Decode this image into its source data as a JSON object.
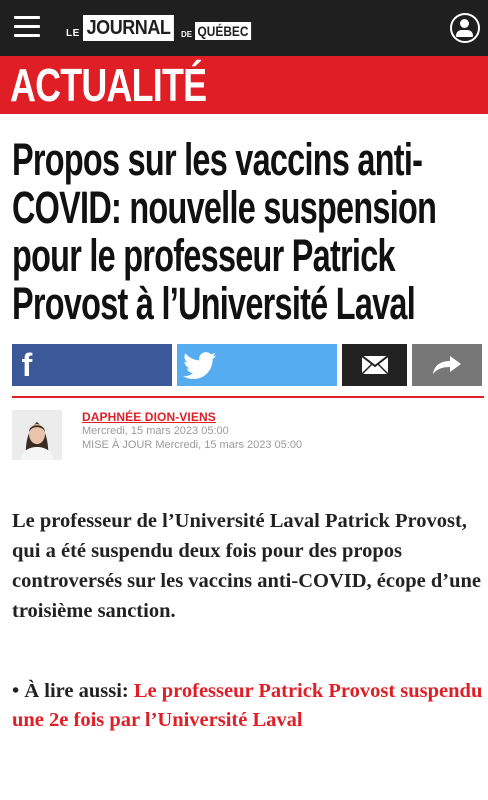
{
  "header": {
    "logo": {
      "le": "LE",
      "journal": "JOURNAL",
      "de": "DE",
      "quebec": "QUÉBEC"
    },
    "menu_icon": "hamburger-menu-icon",
    "account_icon": "user-account-icon",
    "bar_color": "#1f1f1f"
  },
  "section": {
    "label": "ACTUALITÉ",
    "color": "#e01e26"
  },
  "article": {
    "headline": "Propos sur les vaccins anti-COVID: nouvelle suspension pour le professeur Patrick Provost à l’Université Laval",
    "share": {
      "facebook_icon": "facebook-icon",
      "facebook_glyph": "f",
      "twitter_icon": "twitter-icon",
      "email_icon": "email-icon",
      "share_icon": "share-arrow-icon",
      "colors": {
        "facebook": "#3b5998",
        "twitter": "#55acee",
        "email": "#222222",
        "share": "#777777"
      }
    },
    "byline": {
      "author": "DAPHNÉE DION-VIENS",
      "published": "Mercredi, 15 mars 2023 05:00",
      "updated": "MISE À JOUR Mercredi, 15 mars 2023 05:00"
    },
    "lead": "Le professeur de l’Université Laval Patrick Provost, qui a été suspendu deux fois pour des propos controversés sur les vaccins anti-COVID, écope d’une troisième sanction.",
    "related": {
      "bullet": "•",
      "prefix": "À lire aussi:",
      "link_text": "Le professeur Patrick Provost suspendu une 2e fois par l’Université Laval"
    }
  }
}
